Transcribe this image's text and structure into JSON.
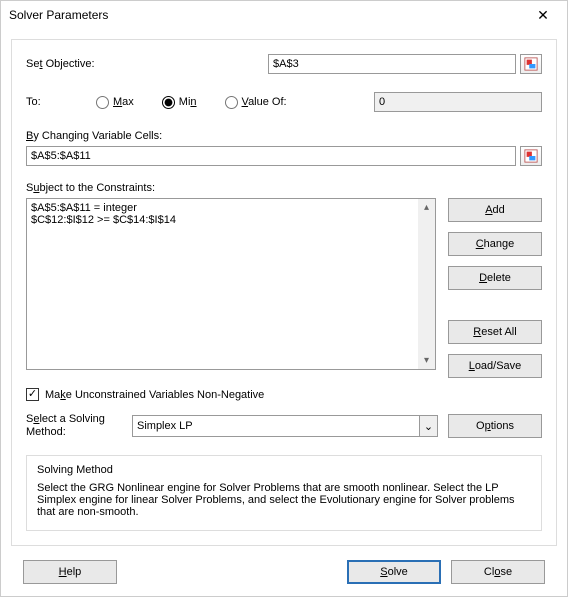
{
  "window": {
    "title": "Solver Parameters"
  },
  "objective": {
    "label": "Set Objective:",
    "value": "$A$3"
  },
  "to": {
    "label": "To:",
    "options": {
      "max": "Max",
      "min": "Min",
      "valueof": "Value Of:"
    },
    "selected": "min",
    "value_of_value": "0"
  },
  "variables": {
    "label": "By Changing Variable Cells:",
    "value": "$A$5:$A$11"
  },
  "constraints": {
    "label": "Subject to the Constraints:",
    "items": [
      "$A$5:$A$11 = integer",
      "$C$12:$I$12 >= $C$14:$I$14"
    ],
    "buttons": {
      "add": "Add",
      "change": "Change",
      "delete": "Delete",
      "reset": "Reset All",
      "loadsave": "Load/Save"
    }
  },
  "nonneg": {
    "label": "Make Unconstrained Variables Non-Negative",
    "checked": true
  },
  "method": {
    "label": "Select a Solving Method:",
    "value": "Simplex LP",
    "options_btn": "Options"
  },
  "info": {
    "title": "Solving Method",
    "body": "Select the GRG Nonlinear engine for Solver Problems that are smooth nonlinear. Select the LP Simplex engine for linear Solver Problems, and select the Evolutionary engine for Solver problems that are non-smooth."
  },
  "footer": {
    "help": "Help",
    "solve": "Solve",
    "close": "Close"
  }
}
